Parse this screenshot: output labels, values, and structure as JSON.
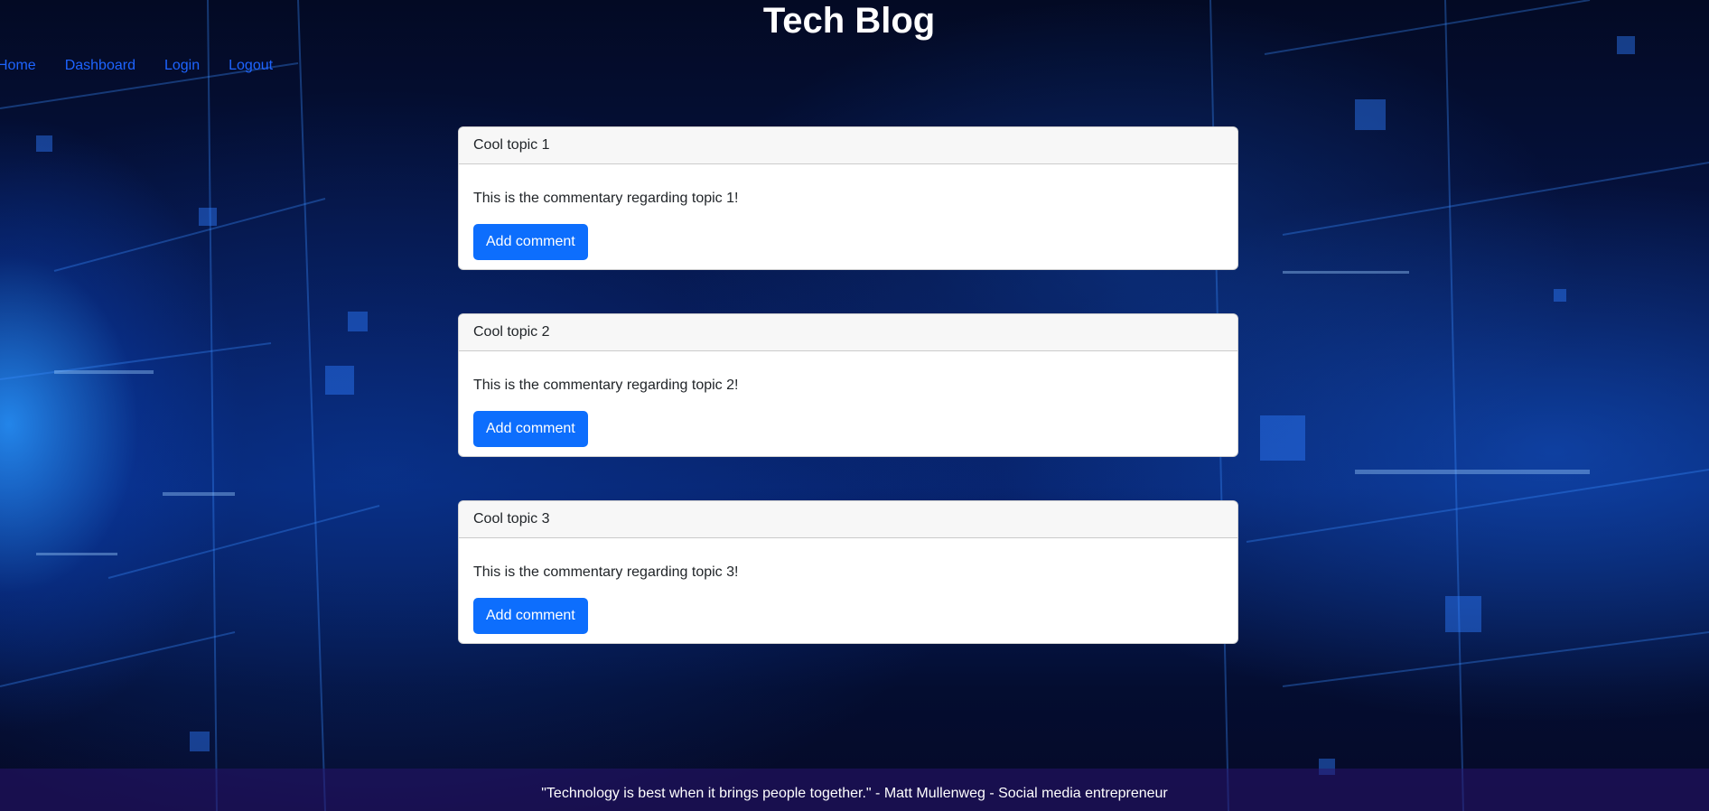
{
  "site": {
    "title": "Tech Blog"
  },
  "nav": {
    "items": [
      {
        "label": "Home"
      },
      {
        "label": "Dashboard"
      },
      {
        "label": "Login"
      },
      {
        "label": "Logout"
      }
    ]
  },
  "posts": [
    {
      "title": "Cool topic 1",
      "body": "This is the commentary regarding topic 1!",
      "button_label": "Add comment"
    },
    {
      "title": "Cool topic 2",
      "body": "This is the commentary regarding topic 2!",
      "button_label": "Add comment"
    },
    {
      "title": "Cool topic 3",
      "body": "This is the commentary regarding topic 3!",
      "button_label": "Add comment"
    }
  ],
  "footer": {
    "quote": "\"Technology is best when it brings people together.\" - Matt Mullenweg - Social media entrepreneur"
  },
  "colors": {
    "link": "#1e64ff",
    "button": "#0d6efd",
    "background": "#06154a"
  }
}
